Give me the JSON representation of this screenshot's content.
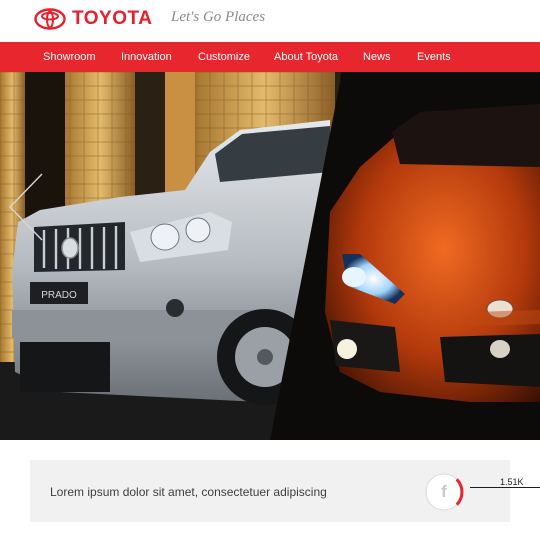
{
  "brand": {
    "name": "TOYOTA",
    "tagline": "Let's Go Places",
    "color": "#e81f2b"
  },
  "nav": {
    "color": "#e8262e",
    "items": [
      {
        "label": "Showroom"
      },
      {
        "label": "Innovation"
      },
      {
        "label": "Customize"
      },
      {
        "label": "About Toyota"
      },
      {
        "label": "News"
      },
      {
        "label": "Events"
      }
    ]
  },
  "hero": {
    "badge_text": "PRADO"
  },
  "info": {
    "text": "Lorem ipsum dolor sit amet, consectetuer adipiscing",
    "share_icon": "facebook-icon",
    "share_count": "1.51K"
  }
}
